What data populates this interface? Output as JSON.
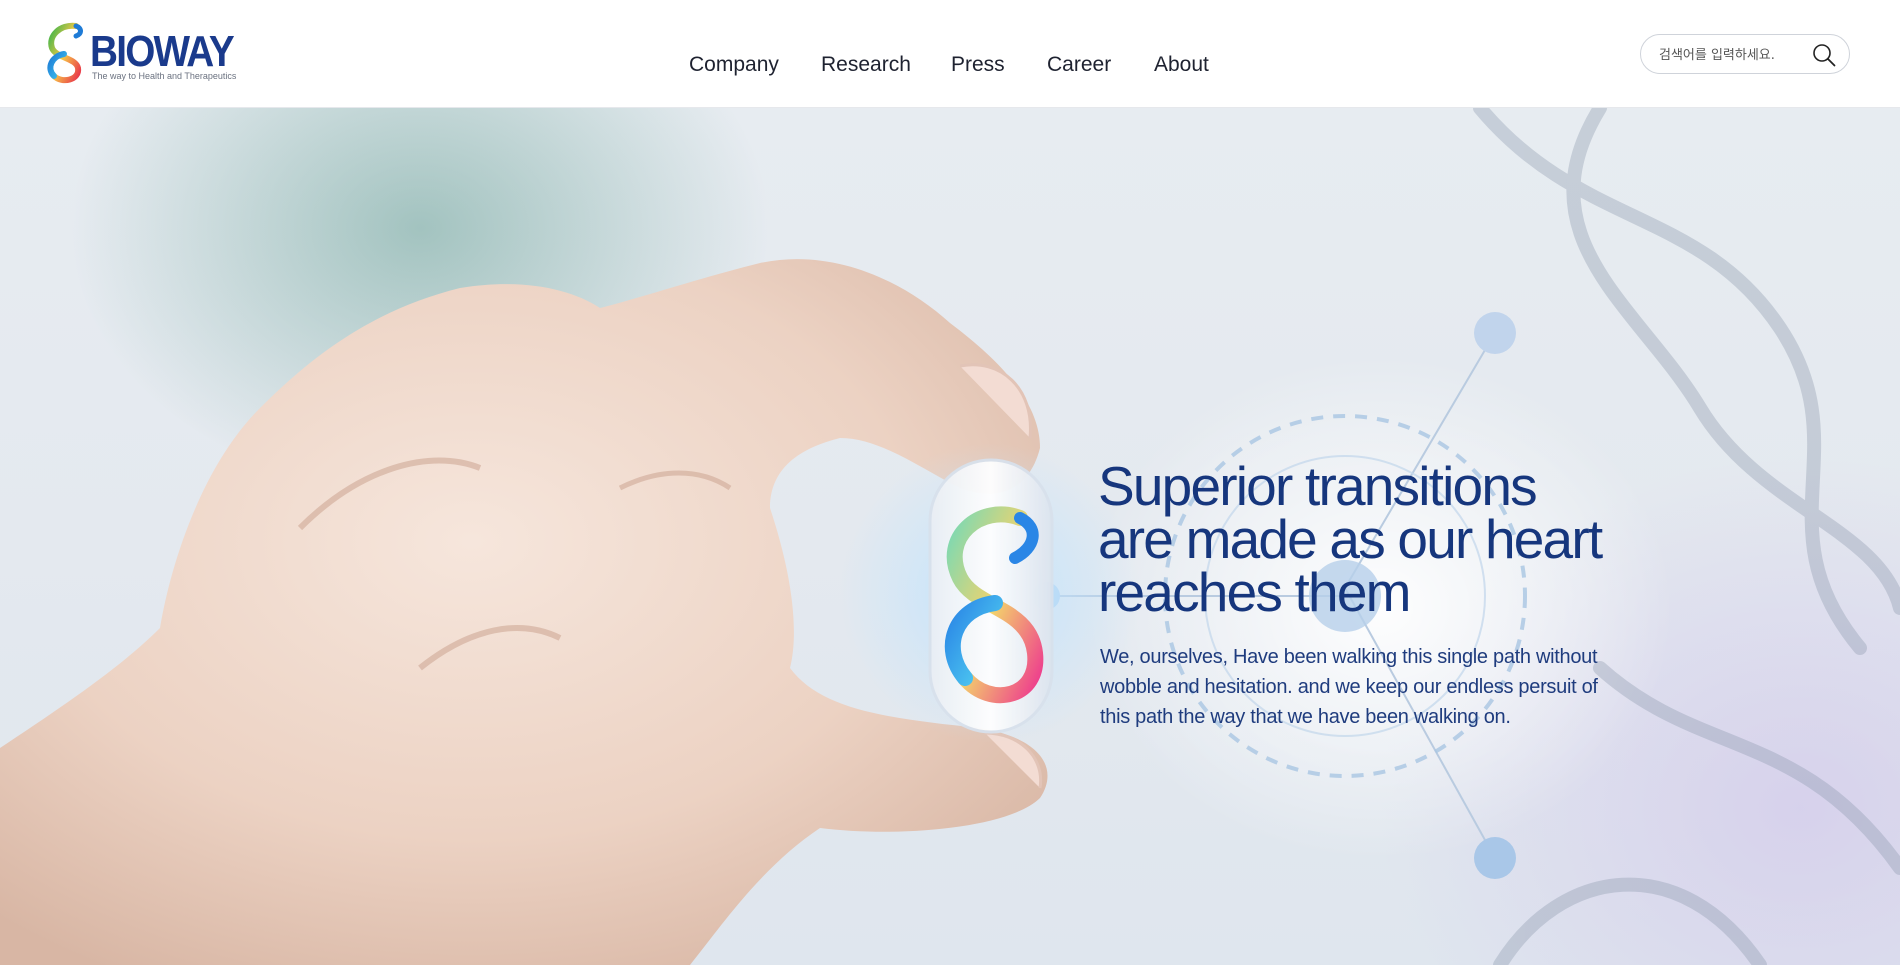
{
  "brand": {
    "name": "BIOWAY",
    "tagline": "The way to Health and Therapeutics",
    "colors": {
      "primary": "#1a3a8c",
      "headline": "#16367d"
    }
  },
  "nav": {
    "items": [
      {
        "label": "Company"
      },
      {
        "label": "Research"
      },
      {
        "label": "Press"
      },
      {
        "label": "Career"
      },
      {
        "label": "About"
      }
    ]
  },
  "search": {
    "placeholder": "검색어를 입력하세요.",
    "value": "",
    "icon": "search-icon"
  },
  "hero": {
    "headline": [
      "Superior transitions",
      "are made as our heart",
      "reaches them"
    ],
    "subtext": [
      "We, ourselves, Have been walking this single path without",
      "wobble and hesitation. and we keep our endless persuit of",
      "this path the way that we have been walking on."
    ]
  }
}
